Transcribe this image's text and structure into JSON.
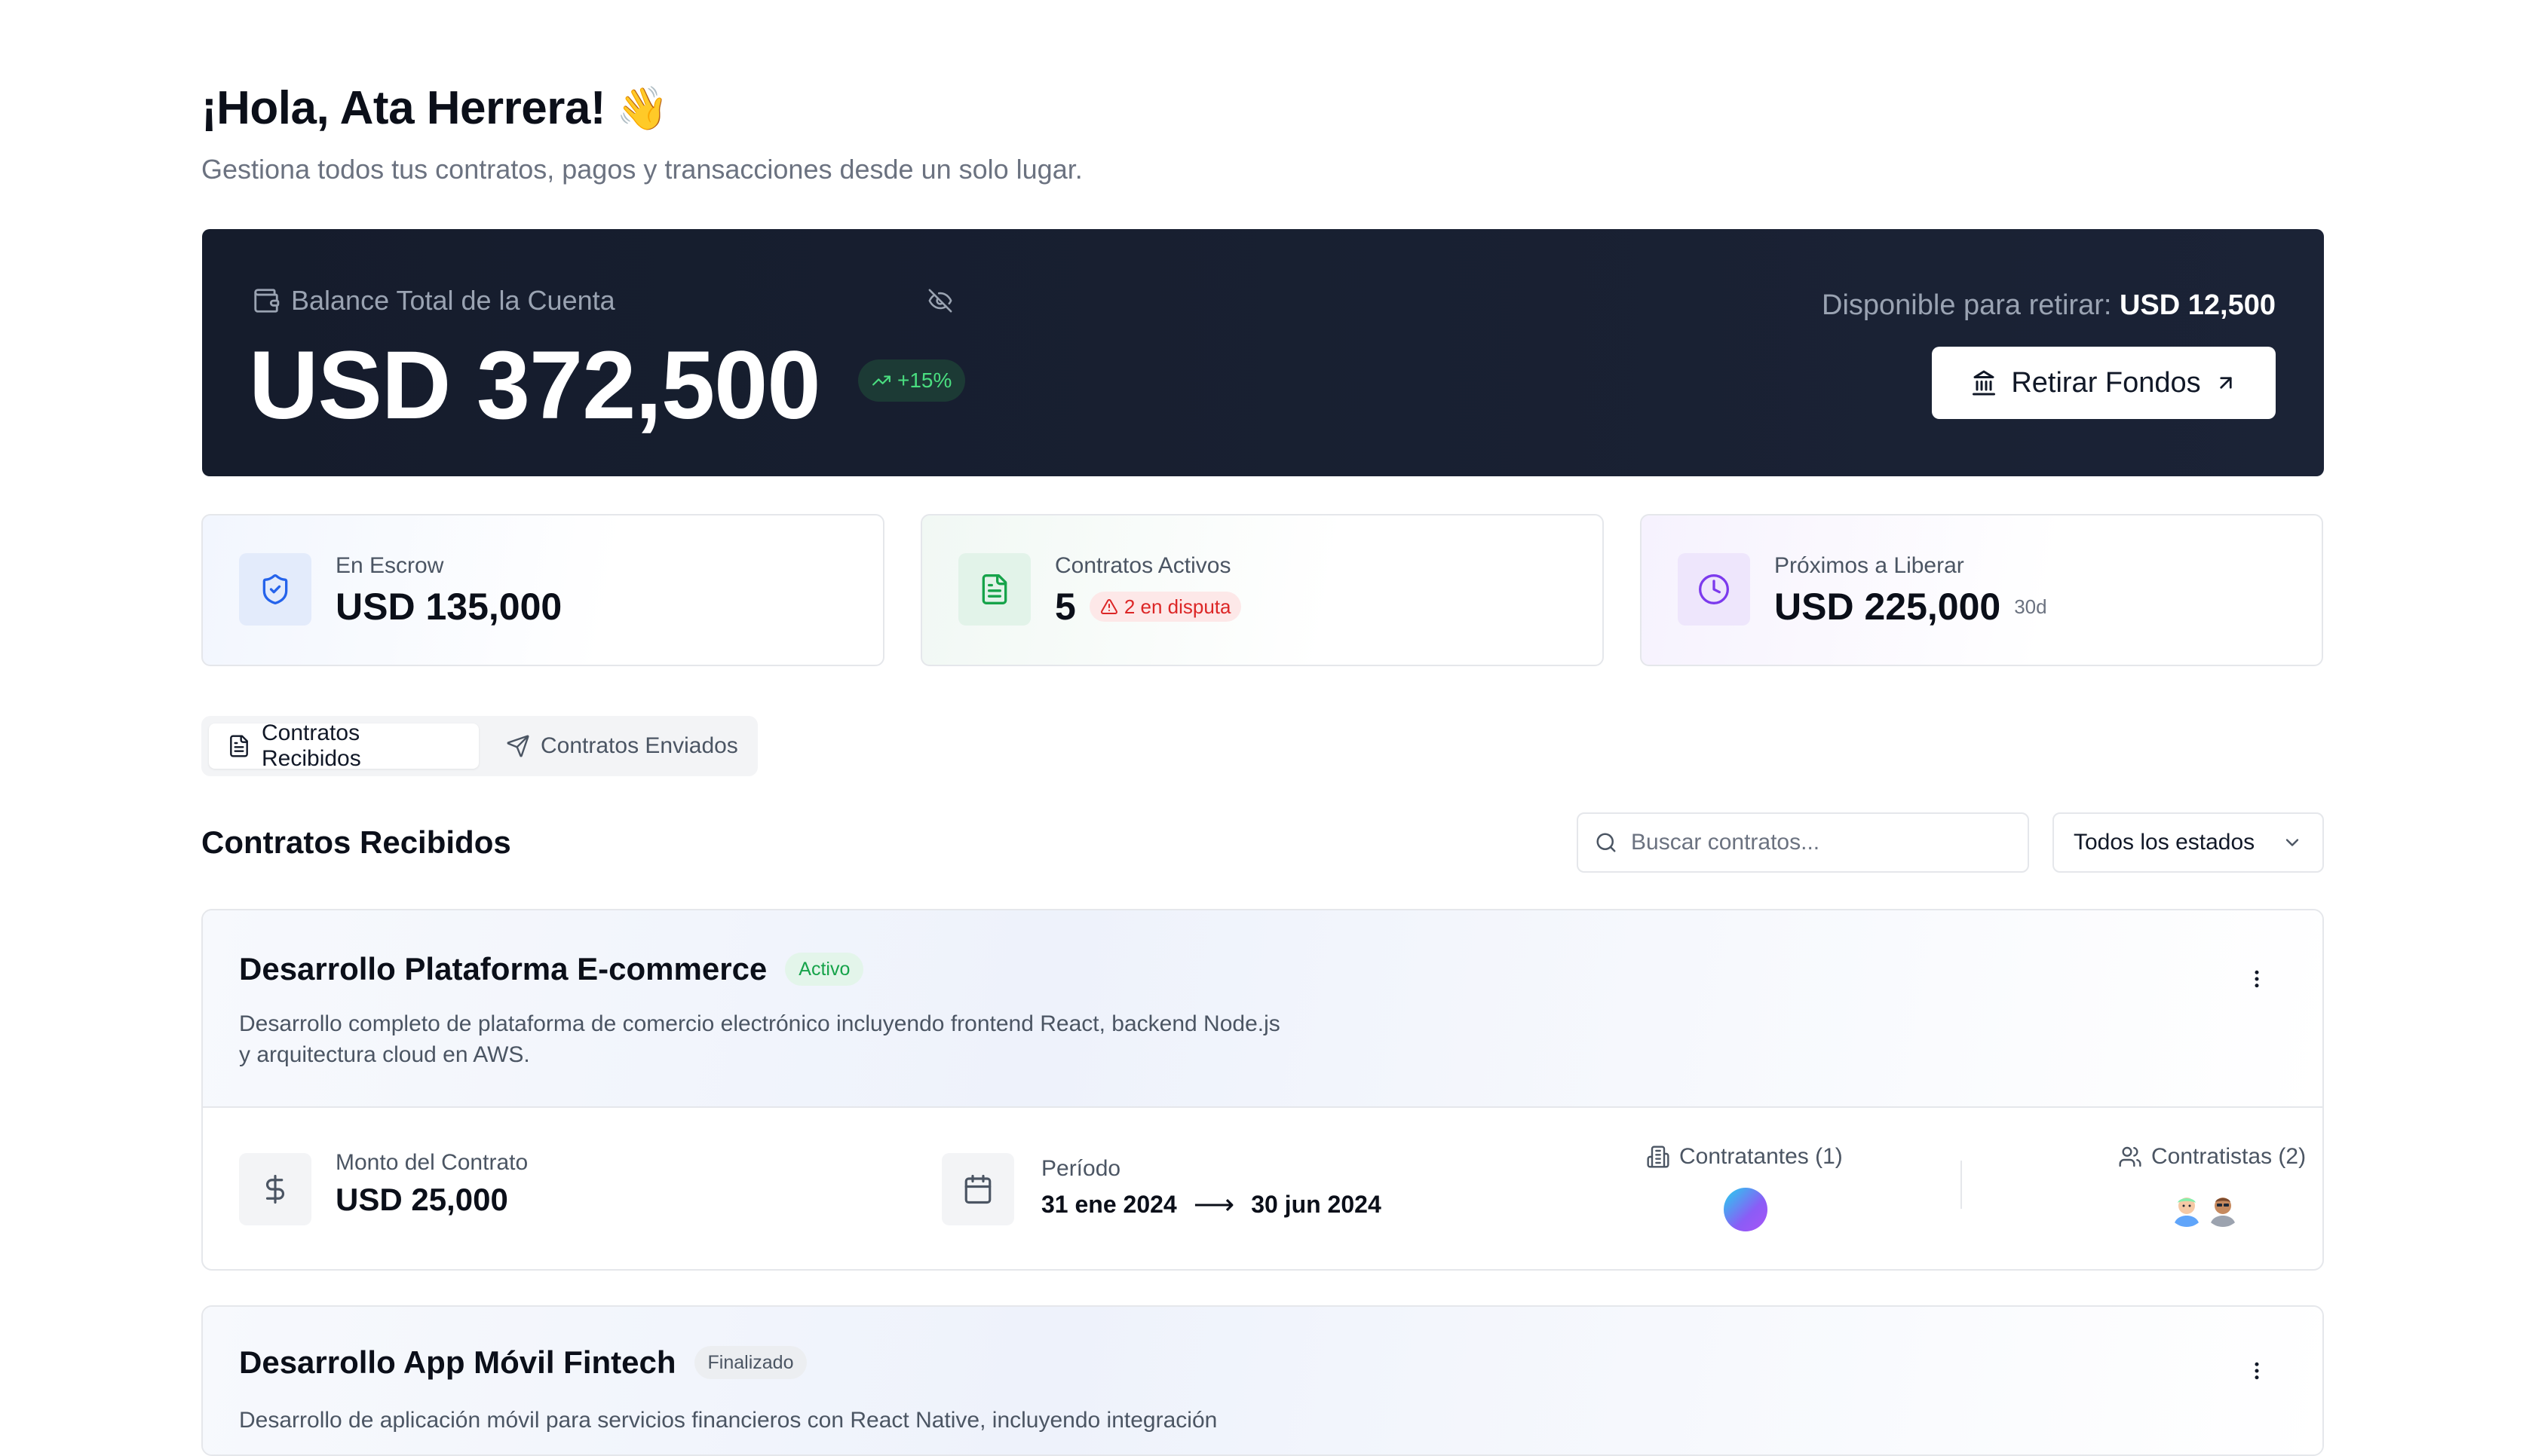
{
  "header": {
    "greeting": "¡Hola, Ata Herrera!",
    "wave_emoji": "👋",
    "subtitle": "Gestiona todos tus contratos, pagos y transacciones desde un solo lugar."
  },
  "balance": {
    "label": "Balance Total de la Cuenta",
    "amount": "USD 372,500",
    "growth": "+15%",
    "available_label": "Disponible para retirar:",
    "available_value": "USD 12,500",
    "withdraw_label": "Retirar Fondos"
  },
  "stats": [
    {
      "label": "En Escrow",
      "value": "USD 135,000",
      "icon": "shield-check-icon",
      "color": "#2563eb"
    },
    {
      "label": "Contratos Activos",
      "value": "5",
      "badge": "2 en disputa",
      "icon": "file-text-icon",
      "color": "#16a34a"
    },
    {
      "label": "Próximos a Liberar",
      "value": "USD 225,000",
      "suffix": "30d",
      "icon": "clock-icon",
      "color": "#7c3aed"
    }
  ],
  "tabs": [
    {
      "label": "Contratos Recibidos",
      "active": true
    },
    {
      "label": "Contratos Enviados",
      "active": false
    }
  ],
  "section": {
    "title": "Contratos Recibidos",
    "search_placeholder": "Buscar contratos...",
    "filter_value": "Todos los estados"
  },
  "contracts": [
    {
      "title": "Desarrollo Plataforma E-commerce",
      "status": "Activo",
      "description": "Desarrollo completo de plataforma de comercio electrónico incluyendo frontend React, backend Node.js y arquitectura cloud en AWS.",
      "amount_label": "Monto del Contrato",
      "amount": "USD 25,000",
      "period_label": "Período",
      "start": "31 ene 2024",
      "end": "30 jun 2024",
      "contratantes_label": "Contratantes (1)",
      "contratistas_label": "Contratistas (2)"
    },
    {
      "title": "Desarrollo App Móvil Fintech",
      "status": "Finalizado",
      "description": "Desarrollo de aplicación móvil para servicios financieros con React Native, incluyendo integración"
    }
  ],
  "colors": {
    "dark_card": "#151c2c",
    "accent_green": "#4ade80",
    "danger": "#dc2626"
  }
}
